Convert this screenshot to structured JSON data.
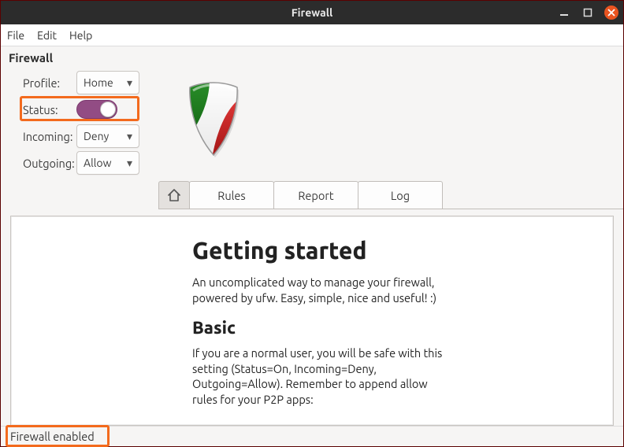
{
  "titlebar": {
    "title": "Firewall"
  },
  "menubar": {
    "file": "File",
    "edit": "Edit",
    "help": "Help"
  },
  "section_title": "Firewall",
  "controls": {
    "profile_label": "Profile:",
    "profile_value": "Home",
    "status_label": "Status:",
    "status_on": true,
    "incoming_label": "Incoming:",
    "incoming_value": "Deny",
    "outgoing_label": "Outgoing:",
    "outgoing_value": "Allow"
  },
  "tabs": {
    "rules": "Rules",
    "report": "Report",
    "log": "Log"
  },
  "content": {
    "h1": "Getting started",
    "p1": "An uncomplicated way to manage your firewall, powered by ufw. Easy, simple, nice and useful! :)",
    "h2": "Basic",
    "p2": "If you are a normal user, you will be safe with this setting (Status=On, Incoming=Deny, Outgoing=Allow). Remember to append allow rules for your P2P apps:"
  },
  "statusbar": {
    "text": "Firewall enabled"
  }
}
